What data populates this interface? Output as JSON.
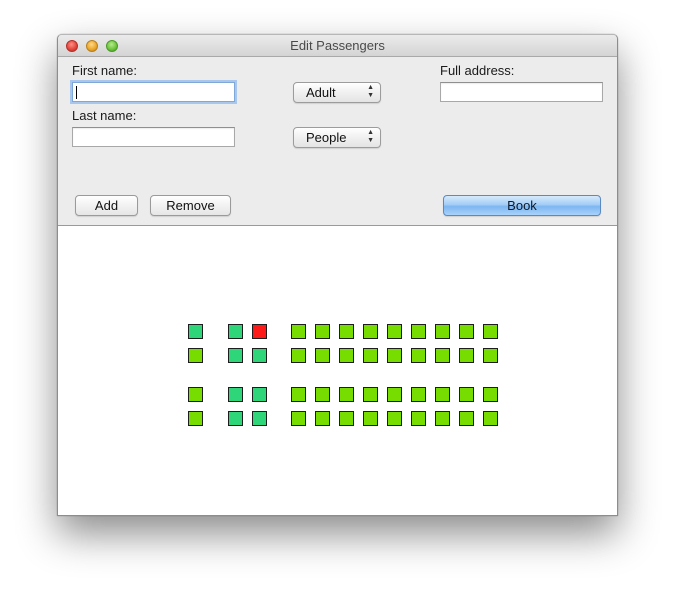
{
  "window": {
    "title": "Edit Passengers"
  },
  "form": {
    "first_name_label": "First name:",
    "first_name_value": "",
    "last_name_label": "Last name:",
    "last_name_value": "",
    "full_address_label": "Full address:",
    "full_address_value": "",
    "passenger_type_selected": "Adult",
    "group_type_selected": "People"
  },
  "buttons": {
    "add_label": "Add",
    "remove_label": "Remove",
    "book_label": "Book"
  },
  "colors": {
    "seat_available": "#77dd00",
    "seat_selected": "#2ed679",
    "seat_taken": "#ff1a1a",
    "book_button": "#8ec4f6"
  },
  "seat_map": {
    "columns": 12,
    "rows": [
      [
        "selected",
        "selected",
        "taken",
        "available",
        "available",
        "available",
        "available",
        "available",
        "available",
        "available",
        "available",
        "available"
      ],
      [
        "available",
        "selected",
        "selected",
        "available",
        "available",
        "available",
        "available",
        "available",
        "available",
        "available",
        "available",
        "available"
      ],
      [
        "available",
        "selected",
        "selected",
        "available",
        "available",
        "available",
        "available",
        "available",
        "available",
        "available",
        "available",
        "available"
      ],
      [
        "available",
        "selected",
        "selected",
        "available",
        "available",
        "available",
        "available",
        "available",
        "available",
        "available",
        "available",
        "available"
      ]
    ]
  }
}
